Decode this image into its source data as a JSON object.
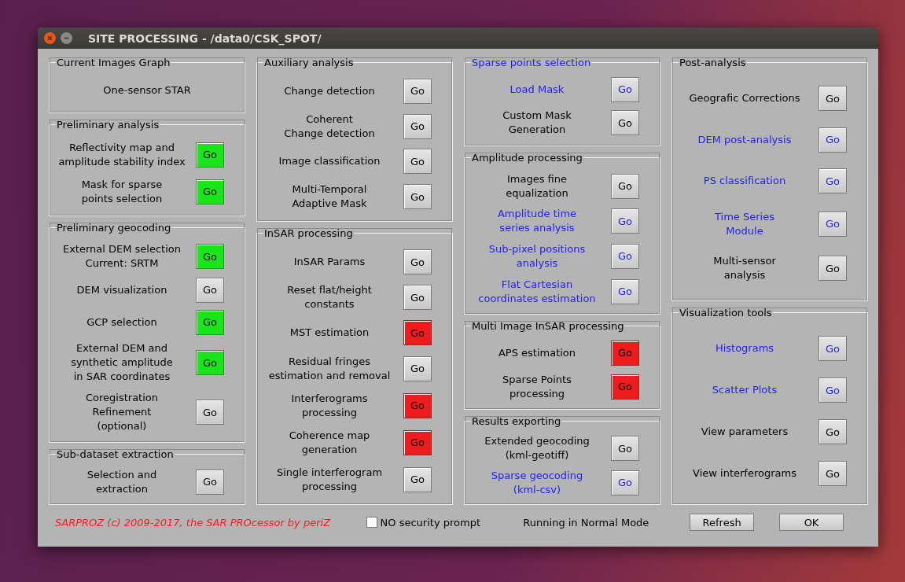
{
  "window": {
    "title": "SITE PROCESSING - /data0/CSK_SPOT/"
  },
  "columns": [
    {
      "panels": [
        {
          "title": "Current Images Graph",
          "color": "#000000",
          "rows": [
            {
              "kind": "text",
              "label": "One-sensor STAR",
              "color": "#000000"
            }
          ]
        },
        {
          "title": "Preliminary analysis",
          "color": "#000000",
          "rows": [
            {
              "kind": "action",
              "label": "Reflectivity map and\namplitude stability index",
              "color": "#000000",
              "button": "Go",
              "done": true,
              "failed": false
            },
            {
              "kind": "action",
              "label": "Mask for sparse\npoints selection",
              "color": "#000000",
              "button": "Go",
              "done": true,
              "failed": false
            }
          ]
        },
        {
          "title": "Preliminary geocoding",
          "color": "#000000",
          "rows": [
            {
              "kind": "action",
              "label": "External DEM selection\nCurrent: SRTM",
              "color": "#000000",
              "button": "Go",
              "done": true,
              "failed": false
            },
            {
              "kind": "action",
              "label": "DEM visualization",
              "color": "#000000",
              "button": "Go",
              "done": false,
              "failed": false
            },
            {
              "kind": "action",
              "label": "GCP selection",
              "color": "#000000",
              "button": "Go",
              "done": true,
              "failed": false
            },
            {
              "kind": "action",
              "label": "External DEM and\nsynthetic amplitude\nin SAR coordinates",
              "color": "#000000",
              "button": "Go",
              "done": true,
              "failed": false
            },
            {
              "kind": "action",
              "label": "Coregistration\nRefinement\n(optional)",
              "color": "#000000",
              "button": "Go",
              "done": false,
              "failed": false
            }
          ]
        },
        {
          "title": "Sub-dataset extraction",
          "color": "#000000",
          "rows": [
            {
              "kind": "action",
              "label": "Selection and\nextraction",
              "color": "#000000",
              "button": "Go",
              "done": false,
              "failed": false
            }
          ]
        }
      ]
    },
    {
      "panels": [
        {
          "title": "Auxiliary analysis",
          "color": "#000000",
          "rows": [
            {
              "kind": "action",
              "label": "Change detection",
              "color": "#000000",
              "button": "Go",
              "done": false,
              "failed": false
            },
            {
              "kind": "action",
              "label": "Coherent\nChange detection",
              "color": "#000000",
              "button": "Go",
              "done": false,
              "failed": false
            },
            {
              "kind": "action",
              "label": "Image classification",
              "color": "#000000",
              "button": "Go",
              "done": false,
              "failed": false
            },
            {
              "kind": "action",
              "label": "Multi-Temporal\nAdaptive Mask",
              "color": "#000000",
              "button": "Go",
              "done": false,
              "failed": false
            }
          ]
        },
        {
          "title": "InSAR processing",
          "color": "#000000",
          "rows": [
            {
              "kind": "action",
              "label": "InSAR Params",
              "color": "#000000",
              "button": "Go",
              "done": false,
              "failed": false
            },
            {
              "kind": "action",
              "label": "Reset flat/height\nconstants",
              "color": "#000000",
              "button": "Go",
              "done": false,
              "failed": false
            },
            {
              "kind": "action",
              "label": "MST estimation",
              "color": "#000000",
              "button": "Go",
              "done": false,
              "failed": true
            },
            {
              "kind": "action",
              "label": "Residual fringes\nestimation and removal",
              "color": "#000000",
              "button": "Go",
              "done": false,
              "failed": false
            },
            {
              "kind": "action",
              "label": "Interferograms\nprocessing",
              "color": "#000000",
              "button": "Go",
              "done": false,
              "failed": true
            },
            {
              "kind": "action",
              "label": "Coherence map\ngeneration",
              "color": "#000000",
              "button": "Go",
              "done": false,
              "failed": true
            },
            {
              "kind": "action",
              "label": "Single interferogram\nprocessing",
              "color": "#000000",
              "button": "Go",
              "done": false,
              "failed": false
            }
          ]
        }
      ]
    },
    {
      "panels": [
        {
          "title": "Sparse points selection",
          "color": "#2222ee",
          "rows": [
            {
              "kind": "action",
              "label": "Load Mask",
              "color": "#2222ee",
              "button": "Go",
              "done": false,
              "failed": false
            },
            {
              "kind": "action",
              "label": "Custom Mask\nGeneration",
              "color": "#000000",
              "button": "Go",
              "done": false,
              "failed": false
            }
          ]
        },
        {
          "title": "Amplitude processing",
          "color": "#000000",
          "rows": [
            {
              "kind": "action",
              "label": "Images fine\nequalization",
              "color": "#000000",
              "button": "Go",
              "done": false,
              "failed": false
            },
            {
              "kind": "action",
              "label": "Amplitude time\nseries analysis",
              "color": "#2222ee",
              "button": "Go",
              "done": false,
              "failed": false
            },
            {
              "kind": "action",
              "label": "Sub-pixel positions\nanalysis",
              "color": "#2222ee",
              "button": "Go",
              "done": false,
              "failed": false
            },
            {
              "kind": "action",
              "label": "Flat Cartesian\ncoordinates estimation",
              "color": "#2222ee",
              "button": "Go",
              "done": false,
              "failed": false
            }
          ]
        },
        {
          "title": "Multi Image InSAR processing",
          "color": "#000000",
          "rows": [
            {
              "kind": "action",
              "label": "APS estimation",
              "color": "#000000",
              "button": "Go",
              "done": false,
              "failed": true
            },
            {
              "kind": "action",
              "label": "Sparse Points\nprocessing",
              "color": "#000000",
              "button": "Go",
              "done": false,
              "failed": true
            }
          ]
        },
        {
          "title": "Results exporting",
          "color": "#000000",
          "rows": [
            {
              "kind": "action",
              "label": "Extended geocoding\n(kml-geotiff)",
              "color": "#000000",
              "button": "Go",
              "done": false,
              "failed": false
            },
            {
              "kind": "action",
              "label": "Sparse geocoding\n(kml-csv)",
              "color": "#2222ee",
              "button": "Go",
              "done": false,
              "failed": false
            }
          ]
        }
      ]
    },
    {
      "panels": [
        {
          "title": "Post-analysis",
          "color": "#000000",
          "rows": [
            {
              "kind": "action",
              "label": "Geografic Corrections",
              "color": "#000000",
              "button": "Go",
              "done": false,
              "failed": false
            },
            {
              "kind": "action",
              "label": "DEM post-analysis",
              "color": "#2222ee",
              "button": "Go",
              "done": false,
              "failed": false
            },
            {
              "kind": "action",
              "label": "PS classification",
              "color": "#2222ee",
              "button": "Go",
              "done": false,
              "failed": false
            },
            {
              "kind": "action",
              "label": "Time Series\nModule",
              "color": "#2222ee",
              "button": "Go",
              "done": false,
              "failed": false
            },
            {
              "kind": "action",
              "label": "Multi-sensor\nanalysis",
              "color": "#000000",
              "button": "Go",
              "done": false,
              "failed": false
            }
          ]
        },
        {
          "title": "Visualization tools",
          "color": "#000000",
          "rows": [
            {
              "kind": "action",
              "label": "Histograms",
              "color": "#2222ee",
              "button": "Go",
              "done": false,
              "failed": false
            },
            {
              "kind": "action",
              "label": "Scatter Plots",
              "color": "#2222ee",
              "button": "Go",
              "done": false,
              "failed": false
            },
            {
              "kind": "action",
              "label": "View parameters",
              "color": "#000000",
              "button": "Go",
              "done": false,
              "failed": false
            },
            {
              "kind": "action",
              "label": "View interferograms",
              "color": "#000000",
              "button": "Go",
              "done": false,
              "failed": false
            }
          ]
        }
      ]
    }
  ],
  "footer": {
    "credit": "SARPROZ (c) 2009-2017, the SAR PROcessor by periZ",
    "security_checkbox": {
      "label": "NO security prompt",
      "checked": false
    },
    "mode": "Running in Normal Mode",
    "buttons": [
      "Refresh",
      "OK"
    ]
  }
}
